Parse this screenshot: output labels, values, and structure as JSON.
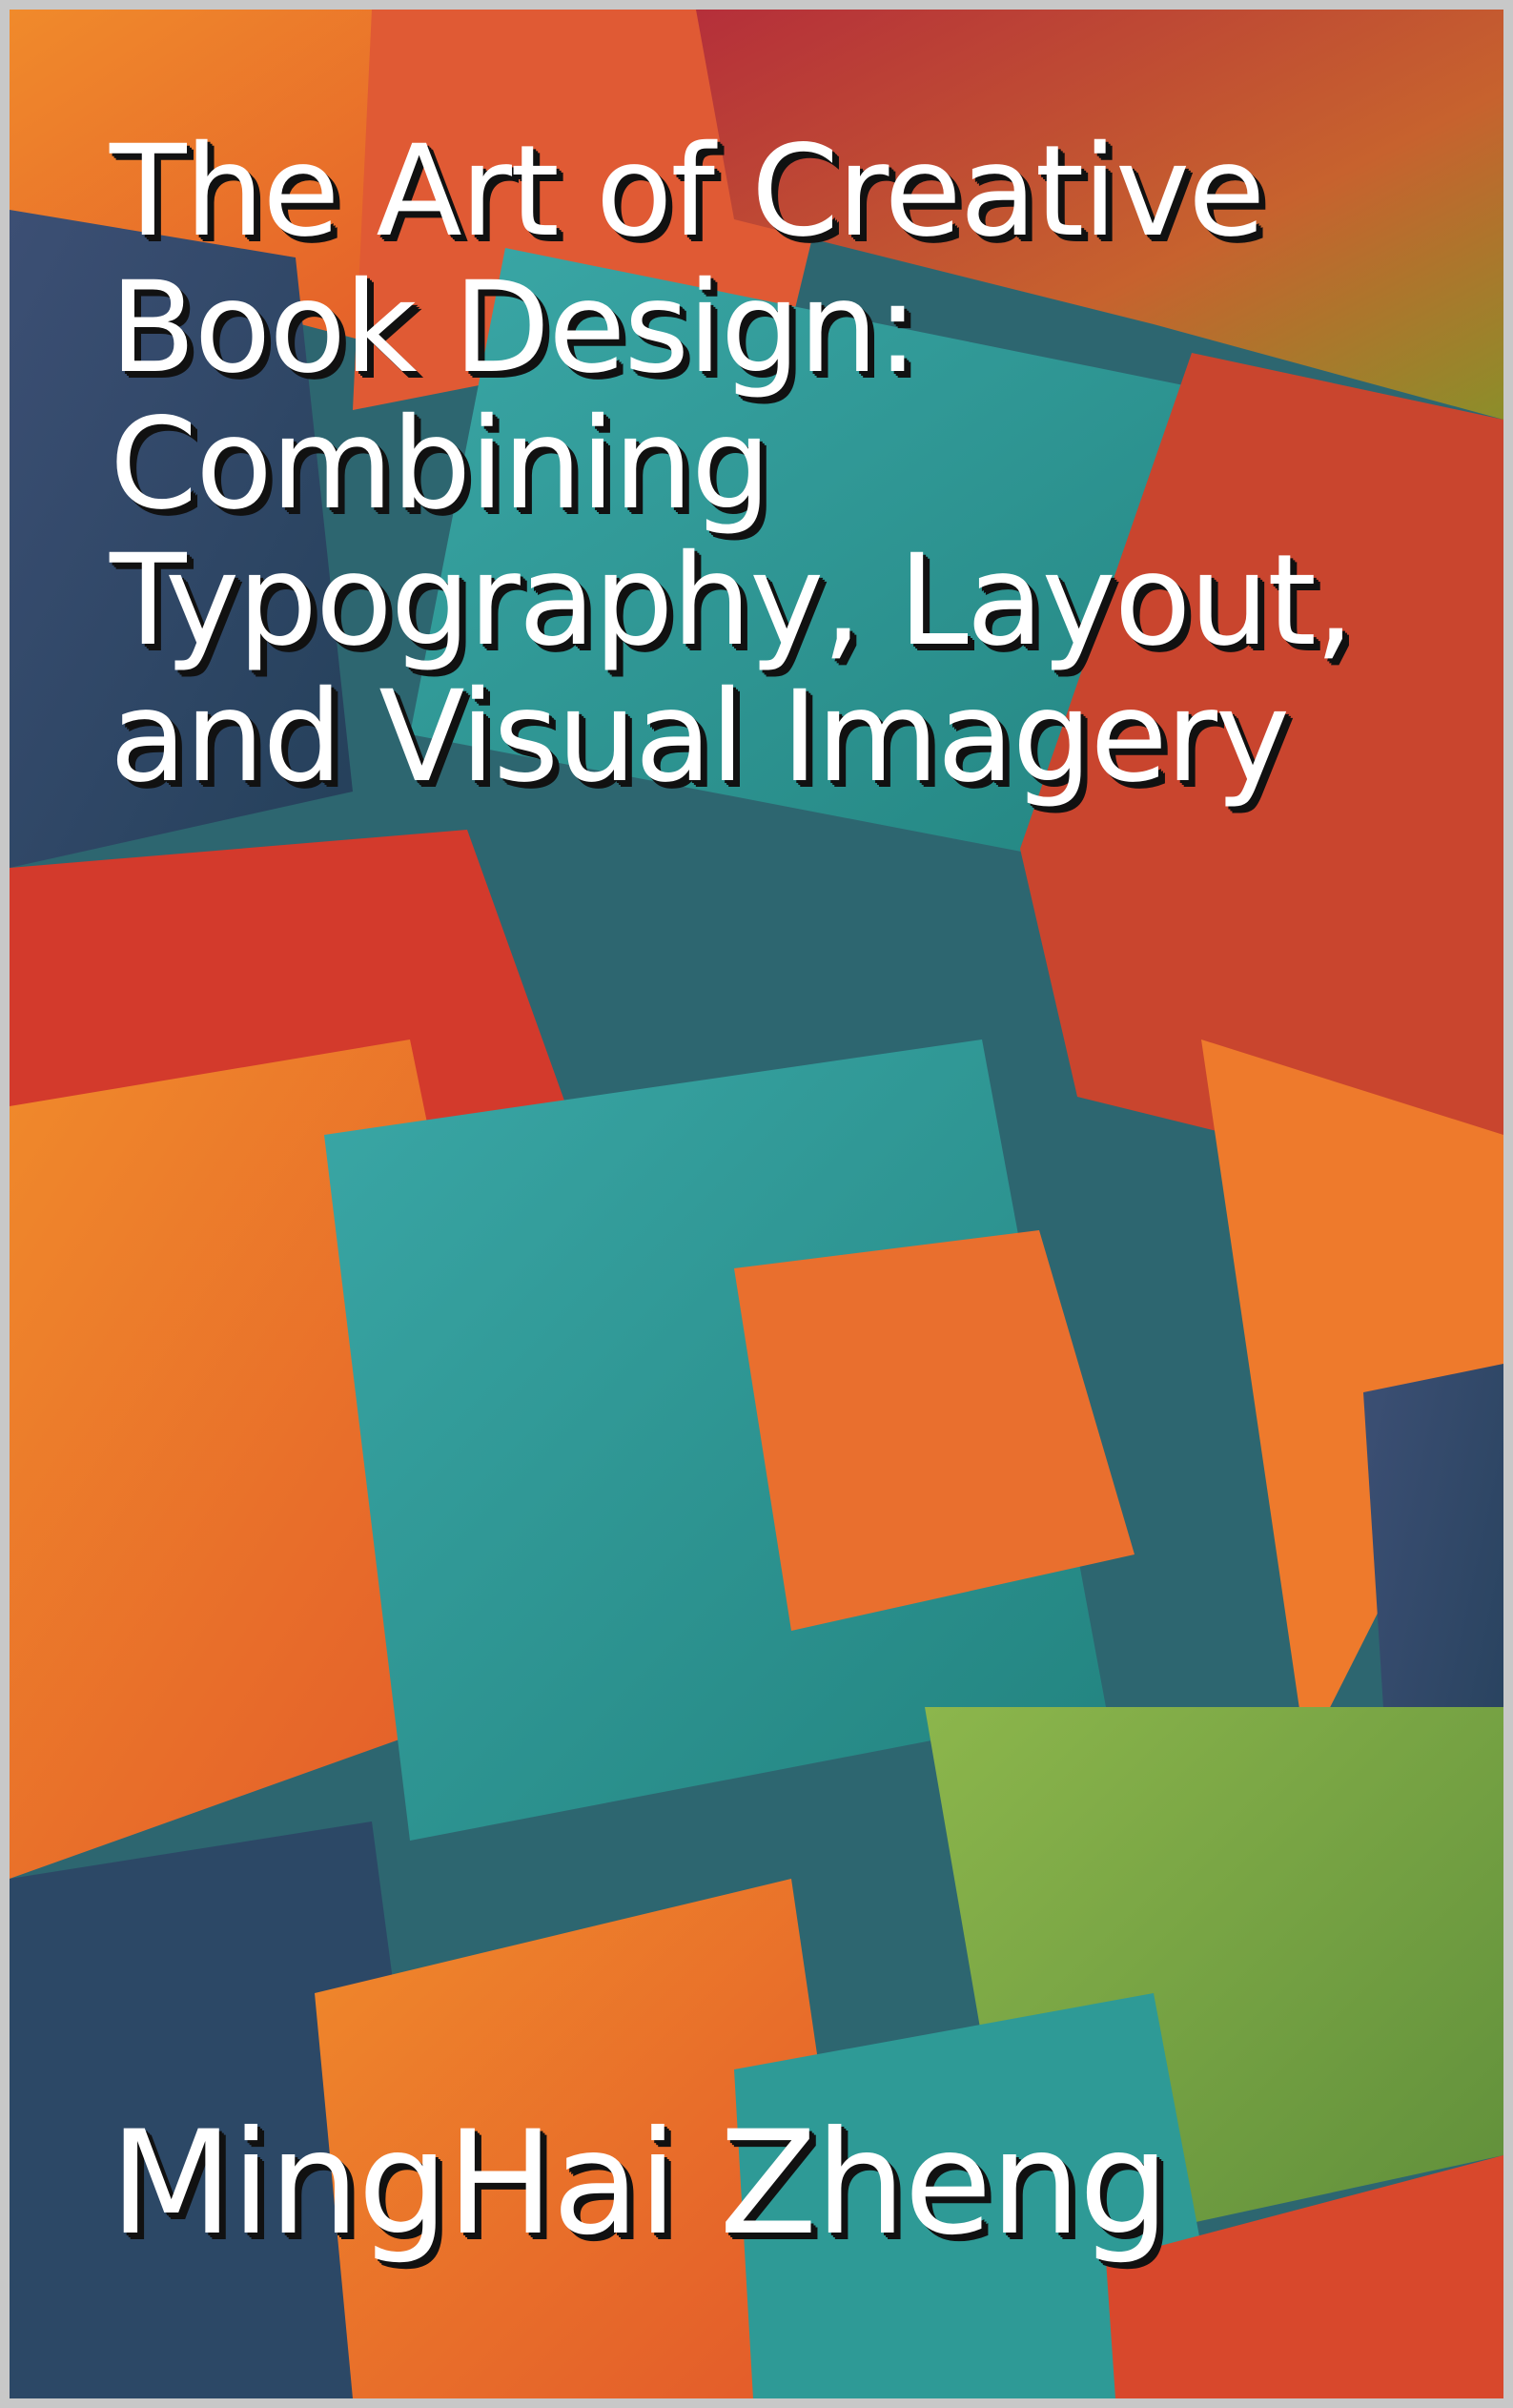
{
  "book": {
    "title": "The Art of Creative Book Design: Combining Typography, Layout, and Visual Imagery",
    "author": "MingHai Zheng"
  },
  "colors": {
    "teal": "#2fa3a0",
    "orange": "#ee7a2a",
    "red": "#d8402f",
    "navy": "#2f4a68",
    "green": "#7fa84a",
    "olive": "#8a8a2a",
    "frame": "#c8c8c8",
    "text": "#ffffff",
    "text_shadow": "#111111"
  }
}
